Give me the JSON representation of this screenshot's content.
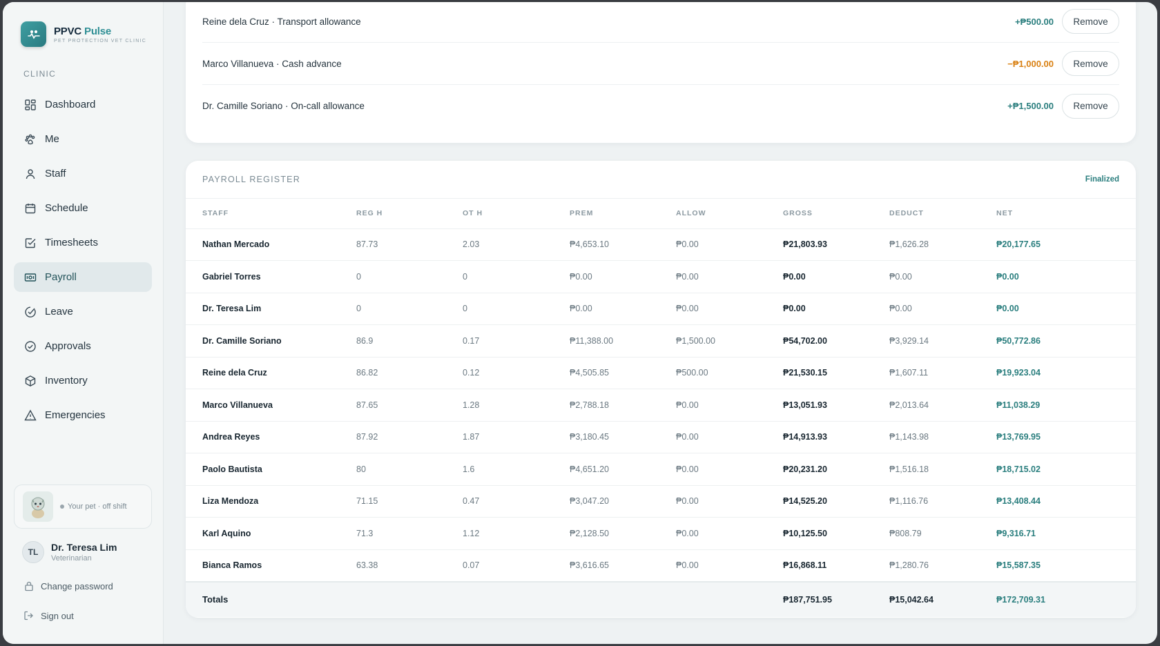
{
  "brand": {
    "name_main": "PPVC",
    "name_accent": "Pulse",
    "subtitle": "PET PROTECTION VET CLINIC"
  },
  "sidebar": {
    "section_label": "CLINIC",
    "items": [
      {
        "label": "Dashboard",
        "icon": "grid-icon"
      },
      {
        "label": "Me",
        "icon": "paw-icon"
      },
      {
        "label": "Staff",
        "icon": "user-icon"
      },
      {
        "label": "Schedule",
        "icon": "calendar-icon"
      },
      {
        "label": "Timesheets",
        "icon": "checkbox-icon"
      },
      {
        "label": "Payroll",
        "icon": "banknote-icon",
        "active": true
      },
      {
        "label": "Leave",
        "icon": "leave-icon"
      },
      {
        "label": "Approvals",
        "icon": "check-circle-icon"
      },
      {
        "label": "Inventory",
        "icon": "box-icon"
      },
      {
        "label": "Emergencies",
        "icon": "warning-icon"
      }
    ],
    "pet_status": "Your pet · off shift",
    "user": {
      "initials": "TL",
      "name": "Dr. Teresa Lim",
      "role": "Veterinarian"
    },
    "change_password": "Change password",
    "sign_out": "Sign out"
  },
  "adjustments": [
    {
      "description": "Reine dela Cruz · Transport allowance",
      "amount": "+₱500.00",
      "type": "pos",
      "action": "Remove"
    },
    {
      "description": "Marco Villanueva · Cash advance",
      "amount": "−₱1,000.00",
      "type": "neg",
      "action": "Remove"
    },
    {
      "description": "Dr. Camille Soriano · On-call allowance",
      "amount": "+₱1,500.00",
      "type": "pos",
      "action": "Remove"
    }
  ],
  "register": {
    "title": "PAYROLL REGISTER",
    "status": "Finalized",
    "columns": [
      "STAFF",
      "REG H",
      "OT H",
      "PREM",
      "ALLOW",
      "GROSS",
      "DEDUCT",
      "NET"
    ],
    "rows": [
      [
        "Nathan Mercado",
        "87.73",
        "2.03",
        "₱4,653.10",
        "₱0.00",
        "₱21,803.93",
        "₱1,626.28",
        "₱20,177.65"
      ],
      [
        "Gabriel Torres",
        "0",
        "0",
        "₱0.00",
        "₱0.00",
        "₱0.00",
        "₱0.00",
        "₱0.00"
      ],
      [
        "Dr. Teresa Lim",
        "0",
        "0",
        "₱0.00",
        "₱0.00",
        "₱0.00",
        "₱0.00",
        "₱0.00"
      ],
      [
        "Dr. Camille Soriano",
        "86.9",
        "0.17",
        "₱11,388.00",
        "₱1,500.00",
        "₱54,702.00",
        "₱3,929.14",
        "₱50,772.86"
      ],
      [
        "Reine dela Cruz",
        "86.82",
        "0.12",
        "₱4,505.85",
        "₱500.00",
        "₱21,530.15",
        "₱1,607.11",
        "₱19,923.04"
      ],
      [
        "Marco Villanueva",
        "87.65",
        "1.28",
        "₱2,788.18",
        "₱0.00",
        "₱13,051.93",
        "₱2,013.64",
        "₱11,038.29"
      ],
      [
        "Andrea Reyes",
        "87.92",
        "1.87",
        "₱3,180.45",
        "₱0.00",
        "₱14,913.93",
        "₱1,143.98",
        "₱13,769.95"
      ],
      [
        "Paolo Bautista",
        "80",
        "1.6",
        "₱4,651.20",
        "₱0.00",
        "₱20,231.20",
        "₱1,516.18",
        "₱18,715.02"
      ],
      [
        "Liza Mendoza",
        "71.15",
        "0.47",
        "₱3,047.20",
        "₱0.00",
        "₱14,525.20",
        "₱1,116.76",
        "₱13,408.44"
      ],
      [
        "Karl Aquino",
        "71.3",
        "1.12",
        "₱2,128.50",
        "₱0.00",
        "₱10,125.50",
        "₱808.79",
        "₱9,316.71"
      ],
      [
        "Bianca Ramos",
        "63.38",
        "0.07",
        "₱3,616.65",
        "₱0.00",
        "₱16,868.11",
        "₱1,280.76",
        "₱15,587.35"
      ]
    ],
    "totals": {
      "label": "Totals",
      "gross": "₱187,751.95",
      "deduct": "₱15,042.64",
      "net": "₱172,709.31"
    }
  },
  "colors": {
    "accent": "#2a7e7e",
    "negative": "#d98012",
    "brand": "#2f8f95"
  }
}
